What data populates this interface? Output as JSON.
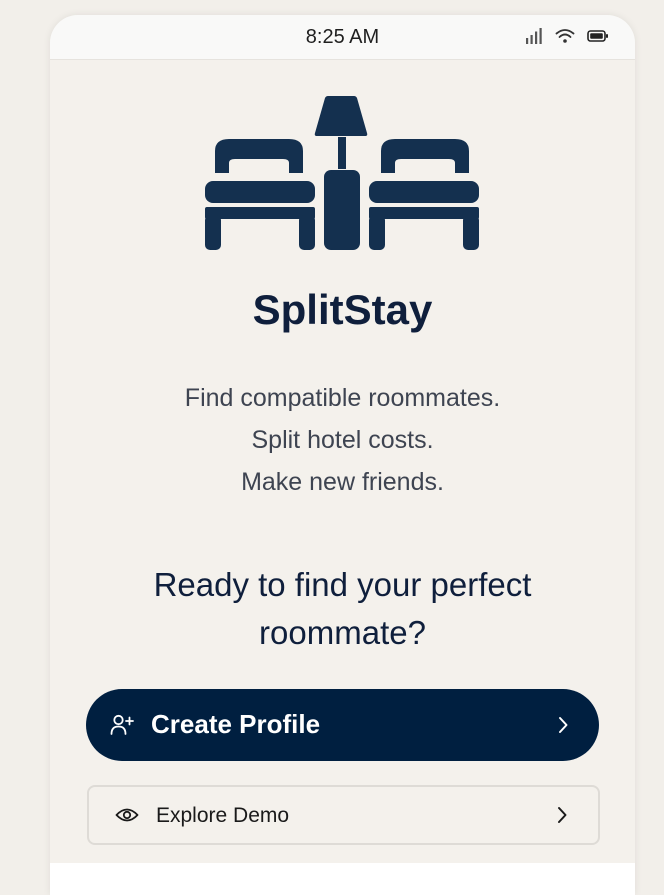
{
  "status_bar": {
    "time": "8:25 AM",
    "icons": [
      "signal-icon",
      "wifi-icon",
      "battery-icon"
    ]
  },
  "app": {
    "logo": "hotel-beds-lamp-icon",
    "name": "SplitStay",
    "tagline": [
      "Find compatible roommates.",
      "Split hotel costs.",
      "Make new friends."
    ]
  },
  "cta": {
    "heading": "Ready to find your perfect roommate?",
    "primary_button": {
      "label": "Create Profile",
      "icon": "user-plus-icon"
    },
    "secondary_button": {
      "label": "Explore Demo",
      "icon": "eye-icon"
    }
  },
  "colors": {
    "primary": "#001f40",
    "text_dark": "#0f1f3c",
    "background": "#f4f1ec",
    "logo": "#14304f"
  }
}
